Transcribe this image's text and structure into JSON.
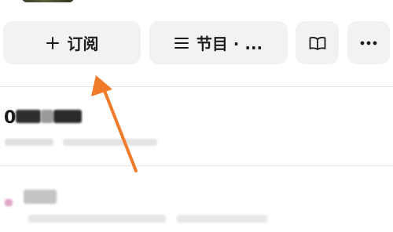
{
  "actions": {
    "subscribe_label": "订阅",
    "episodes_label": "节目 · ...",
    "subscribe_icon": "plus-icon",
    "episodes_icon": "list-icon",
    "book_icon": "book-icon",
    "more_icon": "more-dots-icon"
  },
  "episode1": {
    "title_prefix": "0"
  },
  "colors": {
    "button_bg": "#f2f2f2",
    "arrow": "#f07b2a",
    "divider": "#e6e6e6"
  }
}
